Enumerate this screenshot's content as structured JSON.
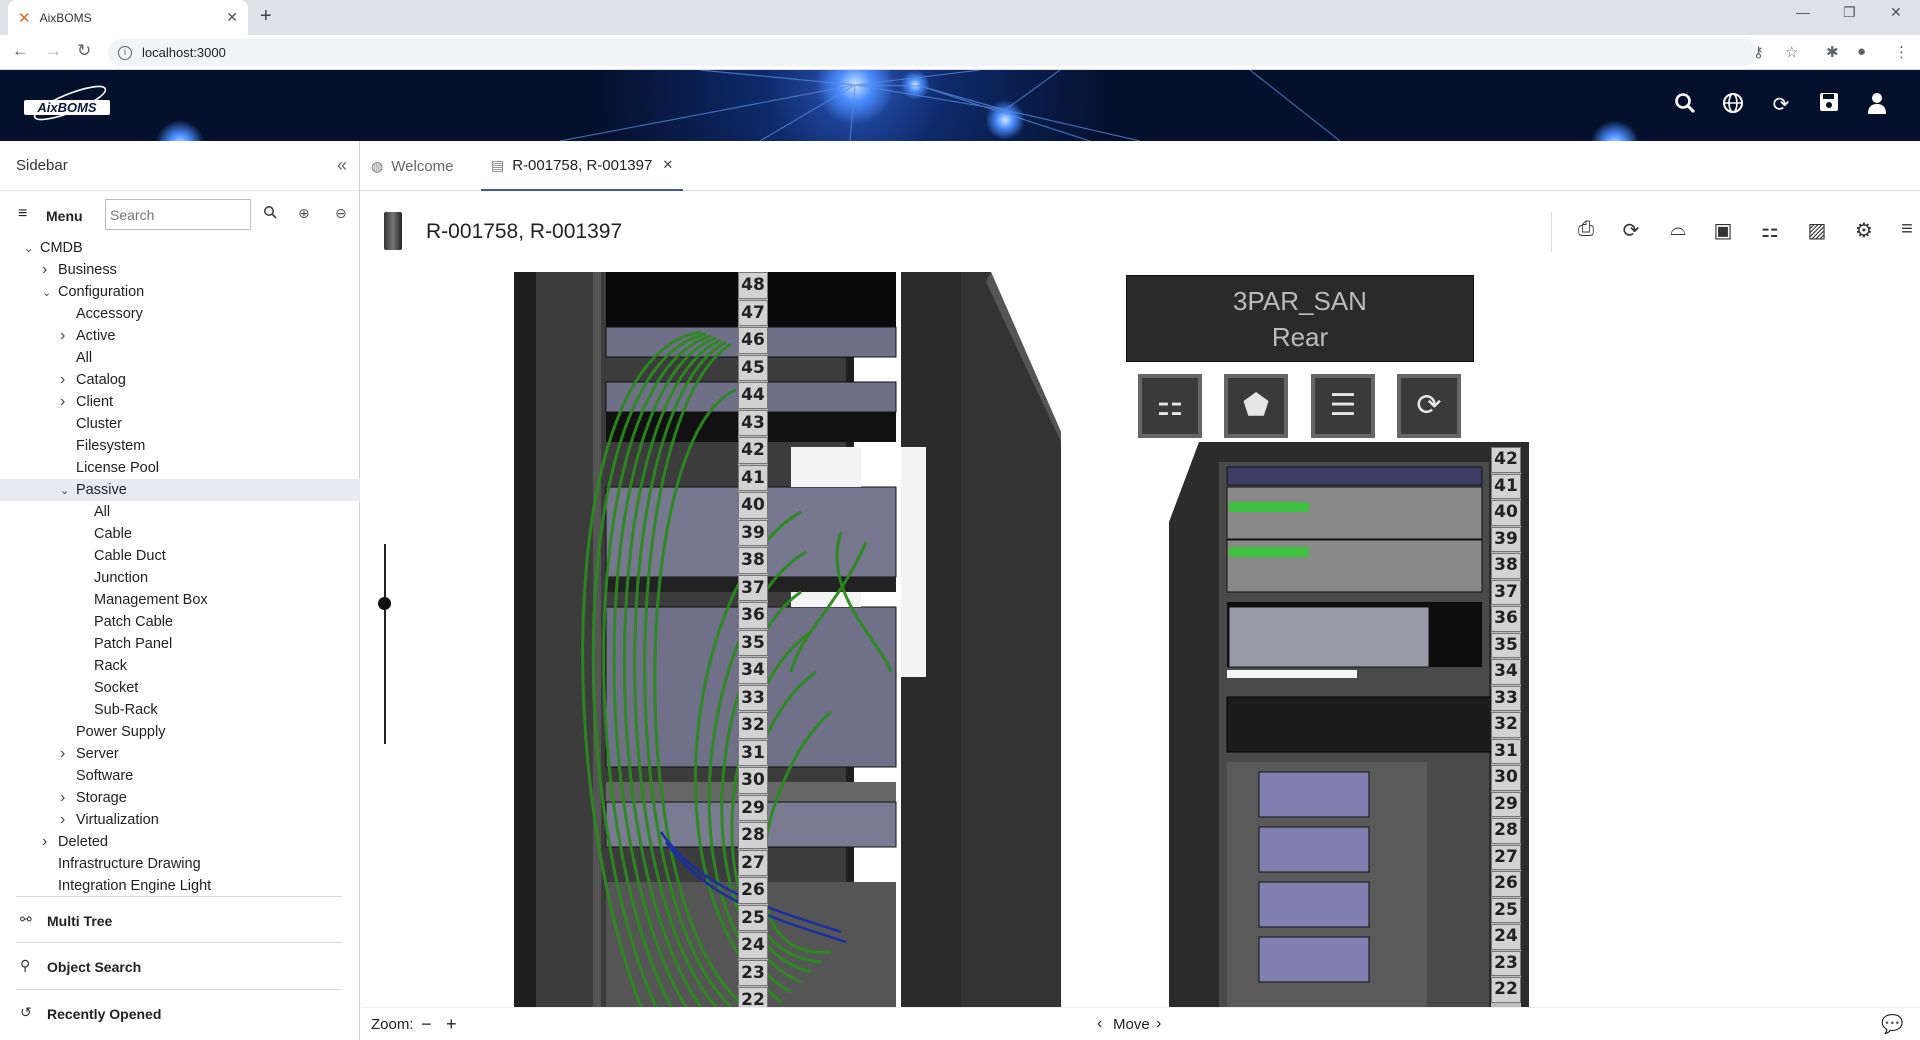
{
  "browser": {
    "tab_title": "AixBOMS",
    "new_tab": "+",
    "url": "localhost:3000"
  },
  "app": {
    "logo_text": "AixBOMS",
    "accent": "#3a5bb0"
  },
  "sidebar": {
    "title": "Sidebar",
    "menu_label": "Menu",
    "search_placeholder": "Search",
    "tree": [
      {
        "label": "CMDB",
        "level": 0,
        "arrow": "down"
      },
      {
        "label": "Business",
        "level": 1,
        "arrow": "right"
      },
      {
        "label": "Configuration",
        "level": 1,
        "arrow": "down"
      },
      {
        "label": "Accessory",
        "level": 2,
        "arrow": ""
      },
      {
        "label": "Active",
        "level": 2,
        "arrow": "right"
      },
      {
        "label": "All",
        "level": 2,
        "arrow": ""
      },
      {
        "label": "Catalog",
        "level": 2,
        "arrow": "right"
      },
      {
        "label": "Client",
        "level": 2,
        "arrow": "right"
      },
      {
        "label": "Cluster",
        "level": 2,
        "arrow": ""
      },
      {
        "label": "Filesystem",
        "level": 2,
        "arrow": ""
      },
      {
        "label": "License Pool",
        "level": 2,
        "arrow": ""
      },
      {
        "label": "Passive",
        "level": 2,
        "arrow": "down",
        "selected": true
      },
      {
        "label": "All",
        "level": 3,
        "arrow": ""
      },
      {
        "label": "Cable",
        "level": 3,
        "arrow": ""
      },
      {
        "label": "Cable Duct",
        "level": 3,
        "arrow": ""
      },
      {
        "label": "Junction",
        "level": 3,
        "arrow": ""
      },
      {
        "label": "Management Box",
        "level": 3,
        "arrow": ""
      },
      {
        "label": "Patch Cable",
        "level": 3,
        "arrow": ""
      },
      {
        "label": "Patch Panel",
        "level": 3,
        "arrow": ""
      },
      {
        "label": "Rack",
        "level": 3,
        "arrow": ""
      },
      {
        "label": "Socket",
        "level": 3,
        "arrow": ""
      },
      {
        "label": "Sub-Rack",
        "level": 3,
        "arrow": ""
      },
      {
        "label": "Power Supply",
        "level": 2,
        "arrow": ""
      },
      {
        "label": "Server",
        "level": 2,
        "arrow": "right"
      },
      {
        "label": "Software",
        "level": 2,
        "arrow": ""
      },
      {
        "label": "Storage",
        "level": 2,
        "arrow": "right"
      },
      {
        "label": "Virtualization",
        "level": 2,
        "arrow": "right"
      },
      {
        "label": "Deleted",
        "level": 1,
        "arrow": "right"
      },
      {
        "label": "Infrastructure Drawing",
        "level": 1,
        "arrow": ""
      },
      {
        "label": "Integration Engine Light",
        "level": 1,
        "arrow": ""
      }
    ],
    "sections": {
      "multi_tree": "Multi Tree",
      "object_search": "Object Search",
      "recently_opened": "Recently Opened"
    }
  },
  "tabs": {
    "welcome": "Welcome",
    "active": "R-001758, R-001397"
  },
  "object": {
    "title": "R-001758, R-001397"
  },
  "viewer": {
    "rack_left_units": [
      48,
      47,
      46,
      45,
      44,
      43,
      42,
      41,
      40,
      39,
      38,
      37,
      36,
      35,
      34,
      33,
      32,
      31,
      30,
      29,
      28,
      27,
      26,
      25,
      24,
      23,
      22
    ],
    "panel_title": "3PAR_SAN",
    "panel_subtitle": "Rear",
    "rack_right_units": [
      42,
      41,
      40,
      39,
      38,
      37,
      36,
      35,
      34,
      33,
      32,
      31,
      30,
      29,
      28,
      27,
      26,
      25,
      24,
      23,
      22
    ]
  },
  "bottom": {
    "zoom_label": "Zoom:",
    "zoom_out": "−",
    "zoom_in": "+",
    "move_label": "Move",
    "move_left": "‹",
    "move_right": "›"
  }
}
